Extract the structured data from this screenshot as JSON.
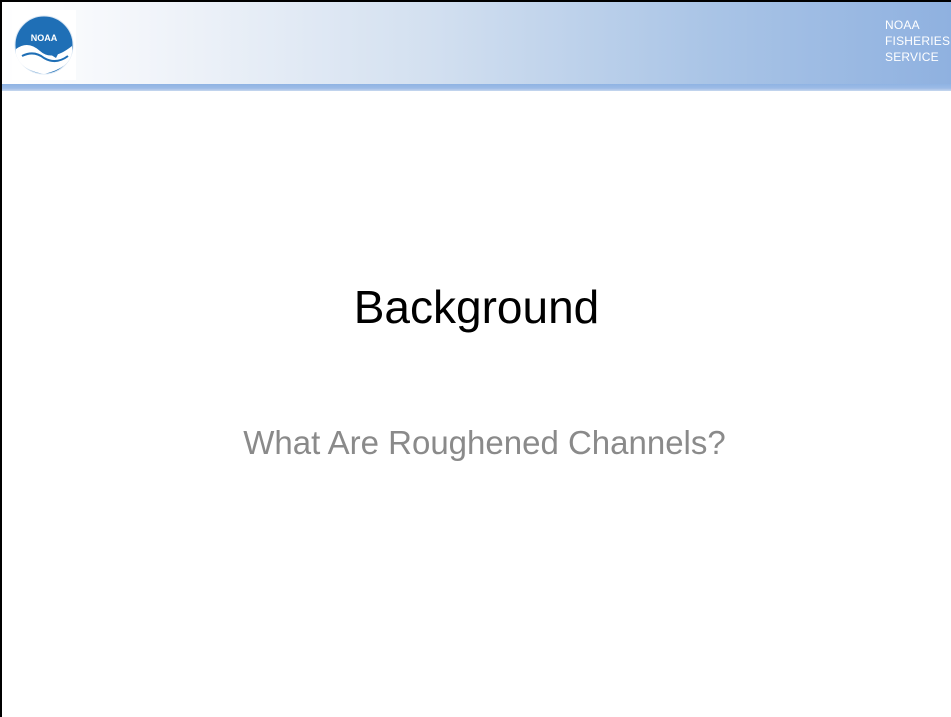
{
  "header": {
    "logo_text": "NOAA",
    "agency_lines": [
      "NOAA",
      "FISHERIES",
      "SERVICE"
    ]
  },
  "slide": {
    "title": "Background",
    "subtitle": "What Are Roughened Channels?"
  },
  "colors": {
    "header_gradient_start": "#ffffff",
    "header_gradient_end": "#8fb1e0",
    "title_color": "#000000",
    "subtitle_color": "#8a8a8a",
    "logo_blue": "#1f6fb6"
  },
  "icons": {
    "logo": "noaa-emblem-icon"
  }
}
